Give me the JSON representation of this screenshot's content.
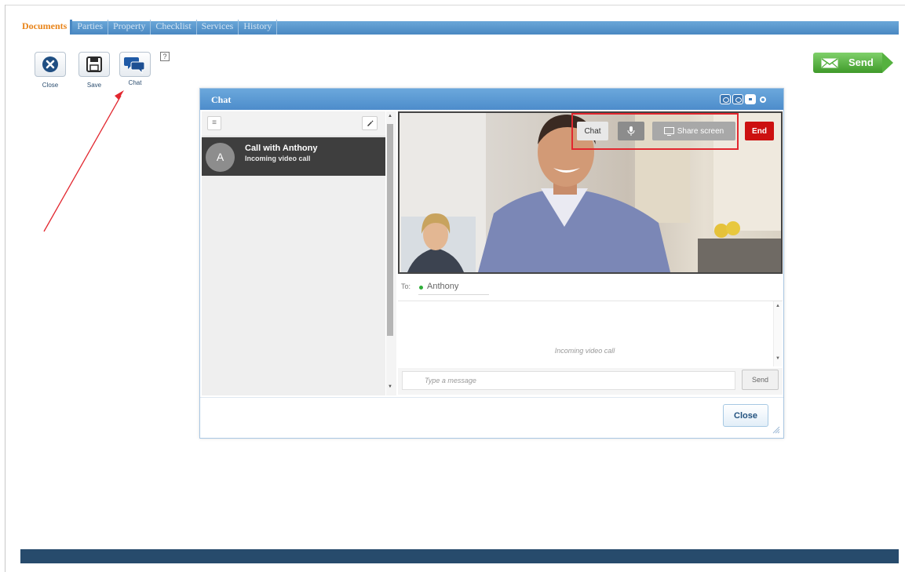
{
  "tabs": [
    {
      "label": "Documents",
      "active": true
    },
    {
      "label": "Parties"
    },
    {
      "label": "Property"
    },
    {
      "label": "Checklist"
    },
    {
      "label": "Services"
    },
    {
      "label": "History"
    }
  ],
  "toolbar": {
    "close_label": "Close",
    "save_label": "Save",
    "chat_label": "Chat",
    "help_label": "?"
  },
  "send_button": {
    "label": "Send"
  },
  "chat": {
    "title": "Chat",
    "contact": {
      "initial": "A",
      "name": "Call with Anthony",
      "status": "Incoming video call"
    },
    "video_controls": {
      "chat": "Chat",
      "share": "Share screen",
      "end": "End"
    },
    "to_label": "To:",
    "recipient": "Anthony",
    "message_note": "Incoming video call",
    "compose_placeholder": "Type a message",
    "send_label": "Send",
    "close_label": "Close"
  },
  "colors": {
    "accent_blue": "#4d8ccb",
    "active_tab": "#e8841a",
    "end_red": "#cc1010",
    "send_green": "#55b13f",
    "highlight": "#e2272f",
    "online": "#2fae3a"
  }
}
